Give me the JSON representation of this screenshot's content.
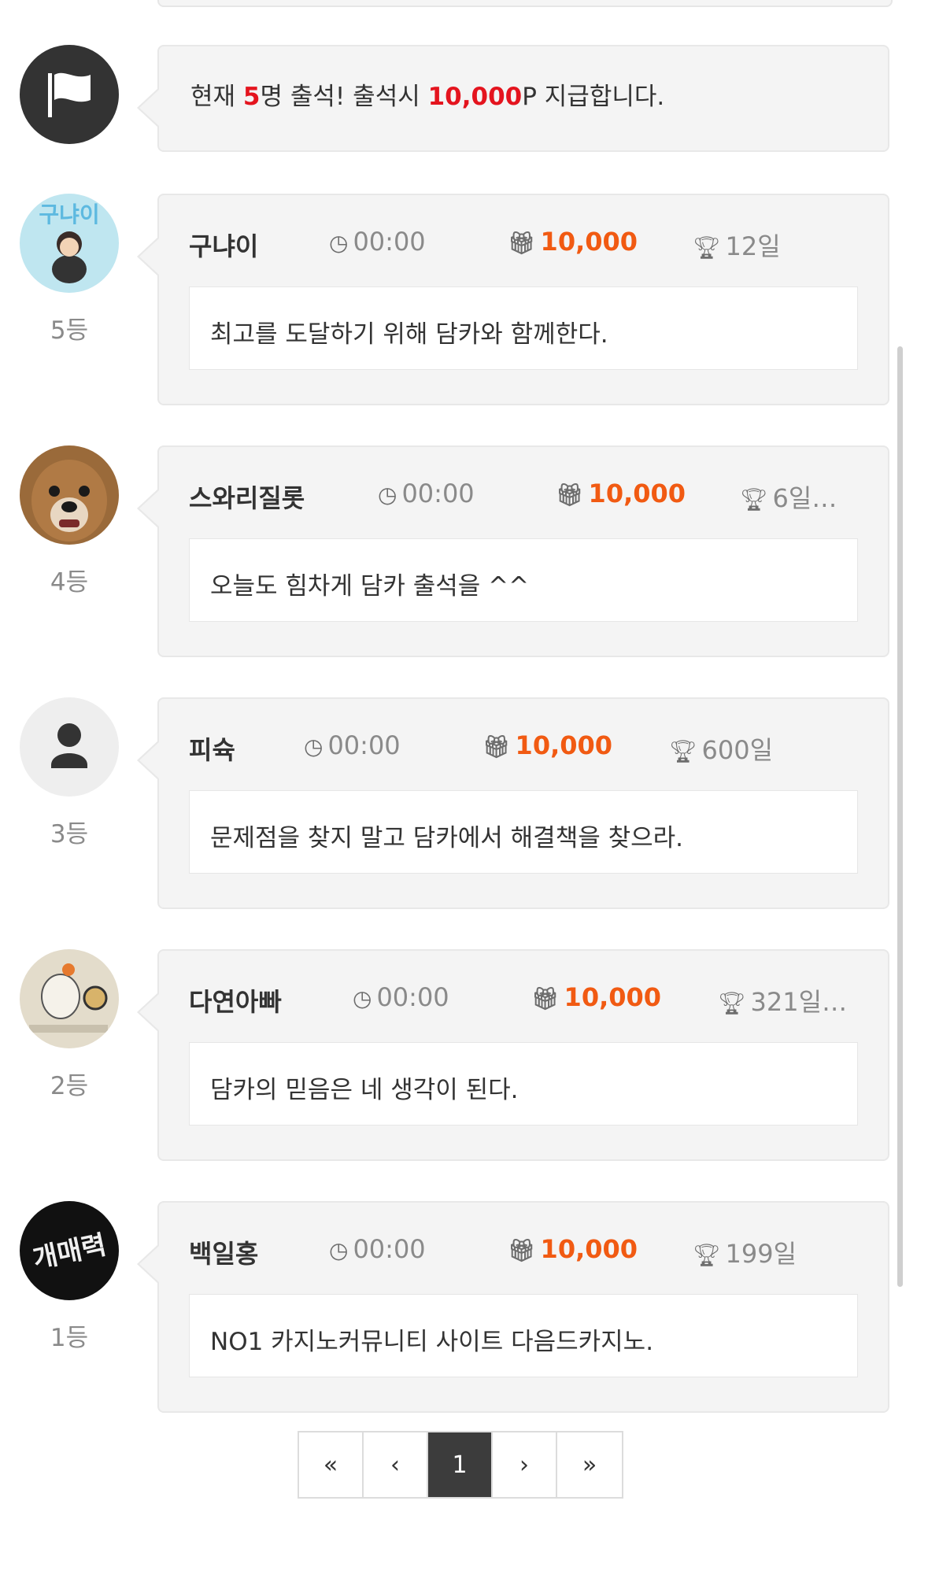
{
  "notice": {
    "prefix": "현재 ",
    "count": "5",
    "mid": "명 출석! 출석시 ",
    "points": "10,000",
    "suffix": "P 지급합니다."
  },
  "entries": [
    {
      "rank": "5등",
      "name": "구냐이",
      "time": "00:00",
      "points": "10,000",
      "days": "12일",
      "message": "최고를 도달하기 위해 담카와 함께한다.",
      "avatar_color": "#bfe6f0"
    },
    {
      "rank": "4등",
      "name": "스와리질롯",
      "time": "00:00",
      "points": "10,000",
      "days": "6일…",
      "message": "오늘도 힘차게 담카 출석을 ^^",
      "avatar_color": "#9a6a3a"
    },
    {
      "rank": "3등",
      "name": "피슉",
      "time": "00:00",
      "points": "10,000",
      "days": "600일",
      "message": "문제점을 찾지 말고 담카에서 해결책을 찾으라.",
      "avatar_color": "#eeeeee"
    },
    {
      "rank": "2등",
      "name": "다연아빠",
      "time": "00:00",
      "points": "10,000",
      "days": "321일…",
      "message": "담카의 믿음은 네 생각이 된다.",
      "avatar_color": "#e3dccb"
    },
    {
      "rank": "1등",
      "name": "백일홍",
      "time": "00:00",
      "points": "10,000",
      "days": "199일",
      "message": "NO1 카지노커뮤니티 사이트 다음드카지노.",
      "avatar_color": "#111111"
    }
  ],
  "avatar_text": {
    "entry1": "구냐이",
    "entry5": "개매력"
  },
  "pagination": {
    "first": "«",
    "prev": "‹",
    "current": "1",
    "next": "›",
    "last": "»"
  },
  "colors": {
    "points": "#f15a12",
    "notice_red": "#e4141e",
    "active_page": "#3c3c3c"
  }
}
